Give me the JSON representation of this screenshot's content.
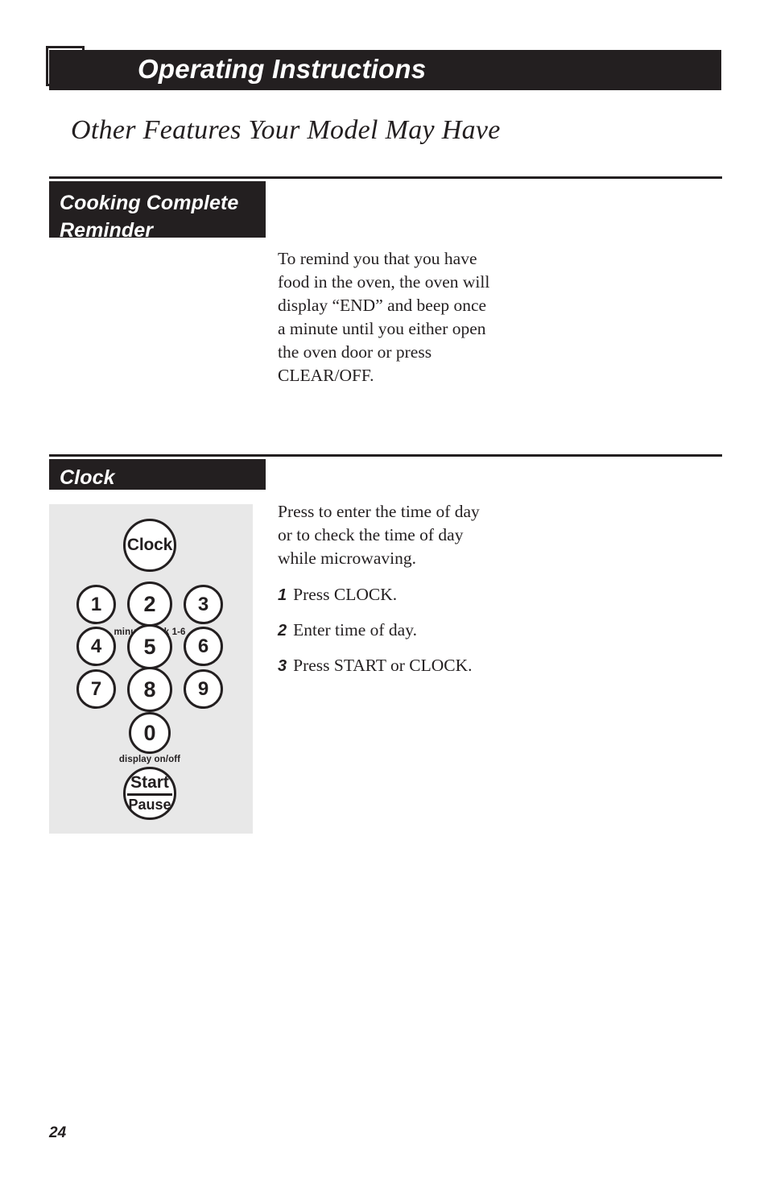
{
  "header": {
    "title": "Operating Instructions",
    "icon": "dial-knob-icon"
  },
  "page_subtitle": "Other Features Your Model May Have",
  "sections": [
    {
      "id": "cooking-complete-reminder",
      "label_line1": "Cooking Complete",
      "label_line2": "Reminder",
      "body": "To remind you that you have food in the oven, the oven will display “END” and beep once a minute until you either open the oven door or press CLEAR/OFF."
    },
    {
      "id": "clock",
      "label_line1": "Clock",
      "body": "Press to enter the time of day or to check the time of day while microwaving.",
      "steps": [
        {
          "num": "1",
          "text": "Press CLOCK."
        },
        {
          "num": "2",
          "text": "Enter time of day."
        },
        {
          "num": "3",
          "text": "Press START or CLOCK."
        }
      ]
    }
  ],
  "keypad": {
    "clock_key": "Clock",
    "digits": [
      "1",
      "2",
      "3",
      "4",
      "5",
      "6",
      "7",
      "8",
      "9",
      "0"
    ],
    "sub_labels": {
      "minute_cook": "minute cook 1-6",
      "display_on_off": "display on/off"
    },
    "start_key": {
      "top": "Start",
      "bottom": "Pause"
    }
  },
  "page_number": "24",
  "colors": {
    "ink": "#231f20",
    "panel_gray": "#e8e8e8",
    "paper": "#ffffff"
  }
}
